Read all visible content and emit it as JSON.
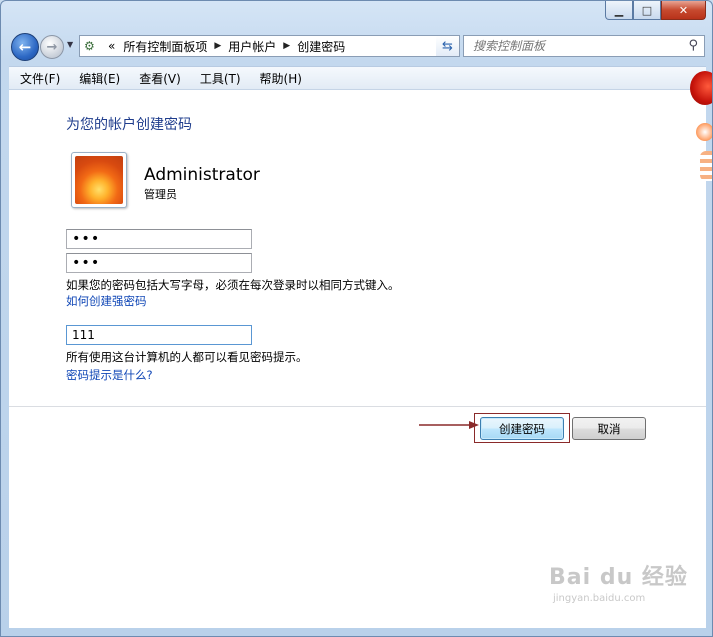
{
  "window": {
    "caption_minimize": "▁",
    "caption_maximize": "□",
    "caption_close": "✕"
  },
  "nav": {
    "back_icon": "arrow-left",
    "forward_icon": "arrow-right",
    "overflow": "«",
    "breadcrumbs": [
      "所有控制面板项",
      "用户帐户",
      "创建密码"
    ],
    "search_placeholder": "搜索控制面板"
  },
  "menu": {
    "items": [
      "文件(F)",
      "编辑(E)",
      "查看(V)",
      "工具(T)",
      "帮助(H)"
    ]
  },
  "main": {
    "heading": "为您的帐户创建密码",
    "user_name": "Administrator",
    "user_role": "管理员",
    "new_password_value": "•••",
    "confirm_password_value": "•••",
    "case_note": "如果您的密码包括大写字母，必须在每次登录时以相同方式键入。",
    "strong_password_link": "如何创建强密码",
    "hint_value": "111",
    "hint_note": "所有使用这台计算机的人都可以看见密码提示。",
    "hint_help_link": "密码提示是什么?",
    "create_button": "创建密码",
    "cancel_button": "取消"
  },
  "watermark": {
    "logo": "Bai du 经验",
    "url": "jingyan.baidu.com"
  },
  "colors": {
    "heading": "#1e3c8c",
    "link": "#0f46b6",
    "annotation": "#8a2a2a"
  }
}
